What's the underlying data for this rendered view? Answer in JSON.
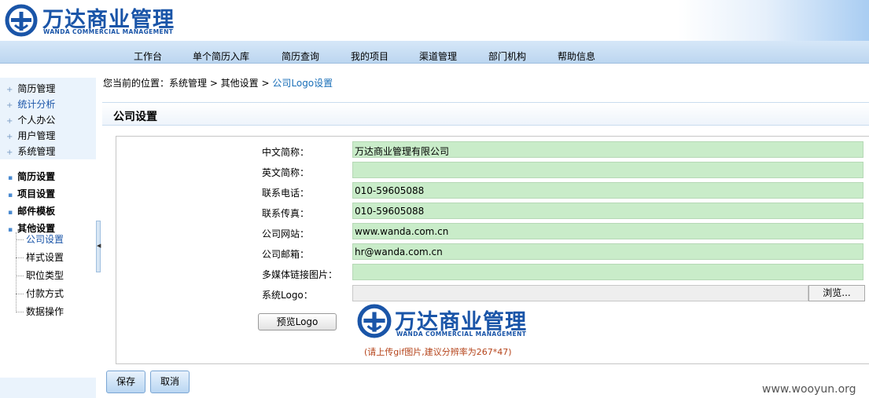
{
  "header": {
    "logo_cn": "万达商业管理",
    "logo_en": "WANDA COMMERCIAL MANAGEMENT"
  },
  "nav": [
    "工作台",
    "单个简历入库",
    "简历查询",
    "我的项目",
    "渠道管理",
    "部门机构",
    "帮助信息"
  ],
  "sidebar": {
    "top_items": [
      "简历管理",
      "统计分析",
      "个人办公",
      "用户管理",
      "系统管理"
    ],
    "groups": [
      "简历设置",
      "项目设置",
      "邮件模板",
      "其他设置"
    ],
    "tree_items": [
      "公司设置",
      "样式设置",
      "职位类型",
      "付款方式",
      "数据操作"
    ]
  },
  "breadcrumb": {
    "prefix": "您当前的位置：系统管理 > 其他设置 > ",
    "current": "公司Logo设置"
  },
  "panel": {
    "title": "公司设置"
  },
  "form": {
    "fields": [
      {
        "label": "中文简称：",
        "value": "万达商业管理有限公司"
      },
      {
        "label": "英文简称：",
        "value": ""
      },
      {
        "label": "联系电话：",
        "value": "010-59605088"
      },
      {
        "label": "联系传真：",
        "value": "010-59605088"
      },
      {
        "label": "公司网站：",
        "value": "www.wanda.com.cn"
      },
      {
        "label": "公司邮箱：",
        "value": "hr@wanda.com.cn"
      },
      {
        "label": "多媒体链接图片：",
        "value": ""
      }
    ],
    "logo_label": "系统Logo：",
    "browse_label": "浏览...",
    "preview_label": "预览Logo",
    "hint": "(请上传gif图片,建议分辨率为267*47)"
  },
  "buttons": {
    "save": "保存",
    "cancel": "取消"
  },
  "watermark": "www.wooyun.org",
  "colors": {
    "brand": "#1a55a8",
    "input_bg": "#c9ecc9",
    "hint": "#b5441b"
  }
}
